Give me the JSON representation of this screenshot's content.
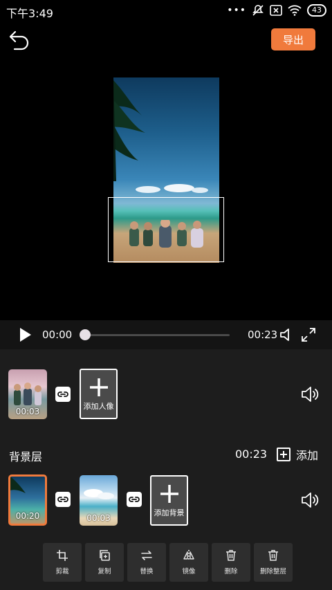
{
  "status_bar": {
    "time": "下午3:49",
    "battery": "43"
  },
  "header": {
    "export_label": "导出"
  },
  "playback": {
    "current_time": "00:00",
    "total_time": "00:23",
    "progress": 0.0
  },
  "portrait_layer": {
    "clip_duration": "00:03",
    "add_label": "添加人像"
  },
  "background_layer": {
    "title": "背景层",
    "duration": "00:23",
    "add_label": "添加",
    "clips": [
      {
        "duration": "00:20",
        "selected": true
      },
      {
        "duration": "00:03",
        "selected": false
      }
    ],
    "add_bg_label": "添加背景"
  },
  "toolbar": {
    "items": [
      {
        "label": "剪裁",
        "icon": "crop-icon"
      },
      {
        "label": "复制",
        "icon": "copy-icon"
      },
      {
        "label": "替换",
        "icon": "replace-icon"
      },
      {
        "label": "镜像",
        "icon": "mirror-icon"
      },
      {
        "label": "删除",
        "icon": "trash-icon"
      },
      {
        "label": "删除整层",
        "icon": "trash-layer-icon"
      }
    ]
  },
  "colors": {
    "accent": "#f07a3c",
    "panel": "#1d1d1d",
    "selected_border": "#f07a3c"
  }
}
